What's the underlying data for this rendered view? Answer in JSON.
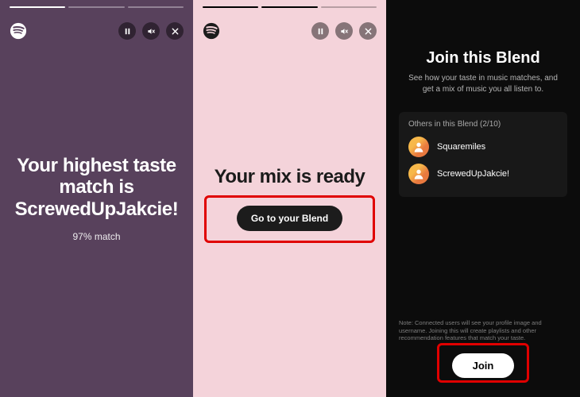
{
  "panel1": {
    "title": "Your highest taste match is ScrewedUpJakcie!",
    "match": "97% match"
  },
  "panel2": {
    "title": "Your mix is ready",
    "cta": "Go to your Blend"
  },
  "panel3": {
    "title": "Join this Blend",
    "desc": "See how your taste in music matches, and get a mix of music you all listen to.",
    "others_label": "Others in this Blend (2/10)",
    "members": [
      {
        "name": "Squaremiles"
      },
      {
        "name": "ScrewedUpJakcie!"
      }
    ],
    "note": "Note: Connected users will see your profile image and username. Joining this will create playlists and other recommendation features that match your taste.",
    "join": "Join"
  },
  "icons": {
    "pause": "pause-icon",
    "mute": "mute-icon",
    "close": "close-icon",
    "spotify": "spotify-logo"
  }
}
